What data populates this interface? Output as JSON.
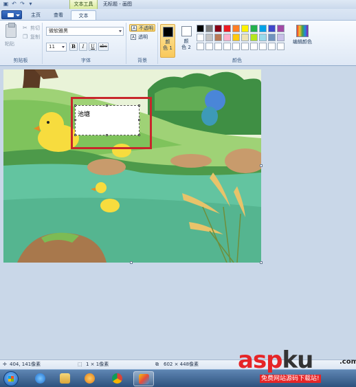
{
  "titlebar": {
    "context_tab": "文本工具",
    "window_title": "无标题 - 画图"
  },
  "tabs": {
    "home": "主页",
    "view": "查看",
    "text": "文本"
  },
  "clipboard": {
    "paste": "粘贴",
    "cut": "剪切",
    "copy": "复制",
    "group_label": "剪贴板"
  },
  "font": {
    "family": "微软雅黑",
    "size": "11",
    "bold": "B",
    "italic": "I",
    "underline": "U",
    "strike": "abc",
    "group_label": "字体"
  },
  "background": {
    "opaque": "不透明",
    "transparent": "透明",
    "group_label": "背景",
    "selected": "opaque"
  },
  "colors": {
    "color1_label_a": "颜",
    "color1_label_b": "色 1",
    "color2_label_a": "颜",
    "color2_label_b": "色 2",
    "color1_value": "#000000",
    "color2_value": "#ffffff",
    "edit_colors": "编辑颜色",
    "group_label": "颜色",
    "palette": [
      "#000000",
      "#7f7f7f",
      "#880015",
      "#ed1c24",
      "#ff7f27",
      "#fff200",
      "#22b14c",
      "#00a2e8",
      "#3f48cc",
      "#a349a4",
      "#ffffff",
      "#c3c3c3",
      "#b97a57",
      "#ffaec9",
      "#ffc90e",
      "#efe4b0",
      "#b5e61d",
      "#99d9ea",
      "#7092be",
      "#c8bfe7",
      "#ffffff",
      "#ffffff",
      "#ffffff",
      "#ffffff",
      "#ffffff",
      "#ffffff",
      "#ffffff",
      "#ffffff",
      "#ffffff",
      "#ffffff"
    ]
  },
  "canvas": {
    "textbox_text": "池塘",
    "highlight_color": "#c8262b"
  },
  "status": {
    "cursor_pos": "404, 141像素",
    "selection_size": "1 × 1像素",
    "image_size": "602 × 448像素"
  },
  "watermark": {
    "main_a": "asp",
    "main_b": "ku",
    "dotcom": ".com",
    "sub": "免费网站源码下载站!"
  },
  "icons": [
    "save-icon",
    "undo-icon",
    "redo-icon",
    "paste-icon",
    "cut-icon",
    "copy-icon",
    "start-icon",
    "ie-icon",
    "explorer-icon",
    "media-icon",
    "chrome-icon",
    "paint-icon"
  ]
}
